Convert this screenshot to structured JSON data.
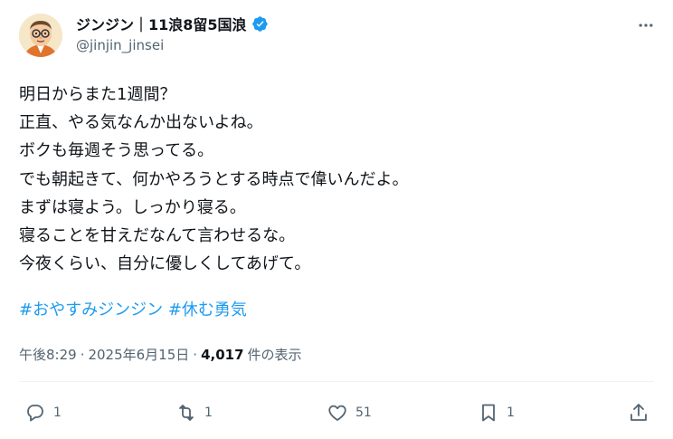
{
  "author": {
    "display_name": "ジンジン｜11浪8留5国浪",
    "handle": "@jinjin_jinsei",
    "verified_icon": "verified-badge-icon",
    "accent_color": "#1d9bf0"
  },
  "tweet": {
    "lines": [
      "明日からまた1週間？",
      "正直、やる気なんか出ないよね。",
      "ボクも毎週そう思ってる。",
      "でも朝起きて、何かやろうとする時点で偉いんだよ。",
      "まずは寝よう。しっかり寝る。",
      "寝ることを甘えだなんて言わせるな。",
      "今夜くらい、自分に優しくしてあげて。"
    ],
    "hashtags": [
      "#おやすみジンジン",
      "#休む勇気"
    ]
  },
  "meta": {
    "time": "午後8:29",
    "separator": "·",
    "date": "2025年6月15日",
    "views": "4,017",
    "views_label": "件の表示"
  },
  "actions": {
    "reply_count": "1",
    "retweet_count": "1",
    "like_count": "51",
    "bookmark_count": "1"
  }
}
